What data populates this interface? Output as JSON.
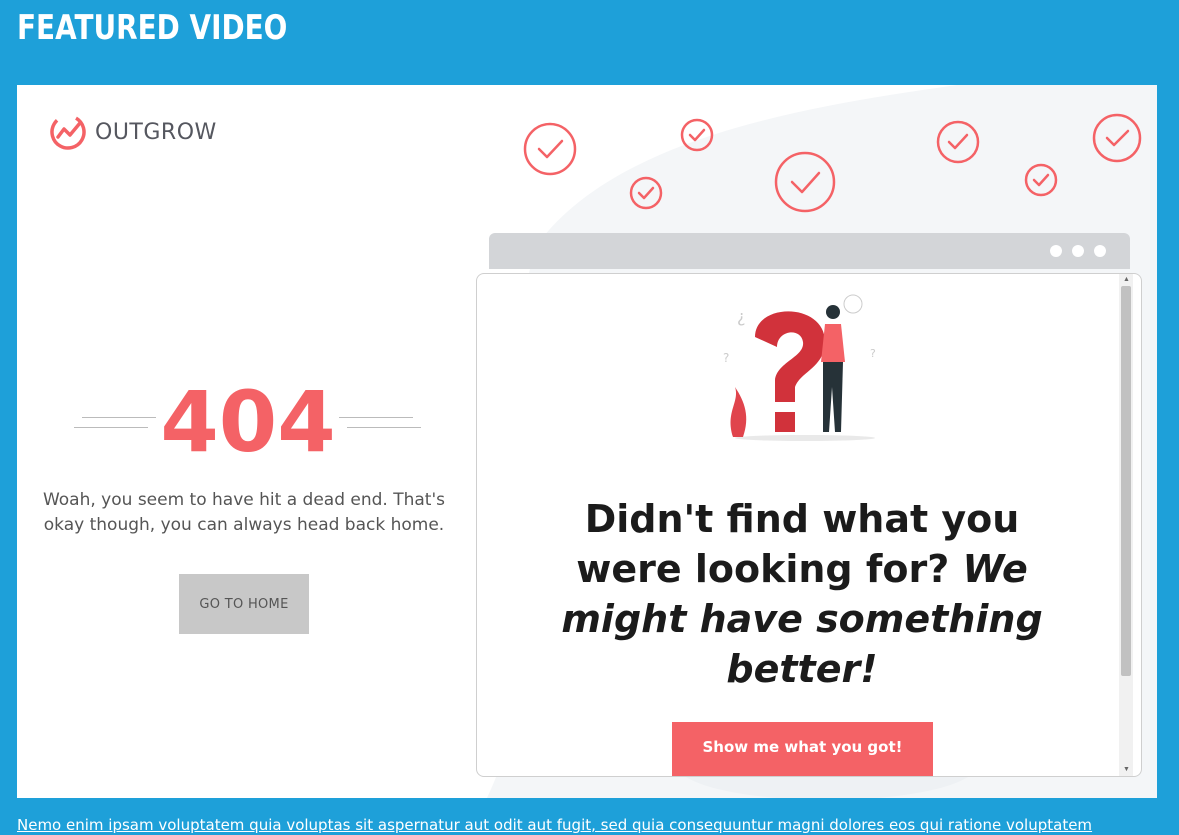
{
  "section": {
    "title": "FEATURED VIDEO"
  },
  "brand": {
    "name": "OUTGROW",
    "accent": "#f46266"
  },
  "error_page": {
    "code": "404",
    "message": "Woah, you seem to have hit a dead end. That's okay though, you can always head back home.",
    "home_button": "GO TO HOME"
  },
  "popup": {
    "heading_plain": "Didn't find what you were looking for?",
    "heading_italic": "We might have something better!",
    "cta": "Show me what you got!"
  },
  "footer": {
    "text": "Nemo enim ipsam voluptatem quia voluptas sit aspernatur aut odit aut fugit, sed quia consequuntur magni dolores eos qui ratione voluptatem"
  },
  "colors": {
    "page_bg": "#1ea0d9",
    "accent": "#f46266",
    "button_grey": "#c8c8c8"
  }
}
